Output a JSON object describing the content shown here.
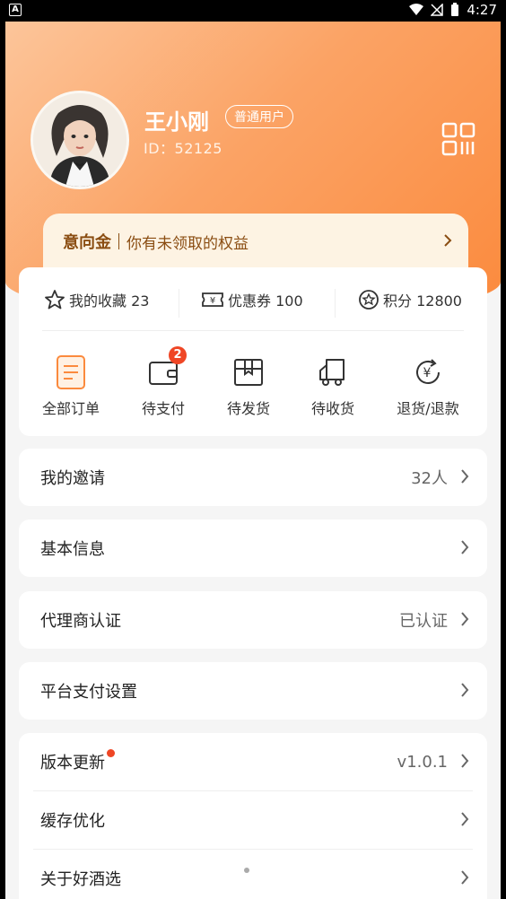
{
  "status_bar": {
    "time": "4:27",
    "left_icon": "A"
  },
  "profile": {
    "name": "王小刚",
    "tag": "普通用户",
    "id_text": "ID：52125"
  },
  "banner": {
    "title": "意向金",
    "text": "你有未领取的权益"
  },
  "stats": [
    {
      "icon": "star-icon",
      "label": "我的收藏 23"
    },
    {
      "icon": "coupon-icon",
      "label": "优惠券 100"
    },
    {
      "icon": "points-icon",
      "label": "积分 12800"
    }
  ],
  "orders": [
    {
      "icon": "order-list-icon",
      "label": "全部订单"
    },
    {
      "icon": "wallet-icon",
      "label": "待支付",
      "badge": "2"
    },
    {
      "icon": "package-icon",
      "label": "待发货"
    },
    {
      "icon": "truck-icon",
      "label": "待收货"
    },
    {
      "icon": "refund-icon",
      "label": "退货/退款"
    }
  ],
  "menu": {
    "invite": {
      "label": "我的邀请",
      "value": "32人"
    },
    "basic_info": {
      "label": "基本信息"
    },
    "agent_cert": {
      "label": "代理商认证",
      "value": "已认证"
    },
    "pay_settings": {
      "label": "平台支付设置"
    },
    "version": {
      "label": "版本更新",
      "value": "v1.0.1"
    },
    "cache": {
      "label": "缓存优化"
    },
    "about": {
      "label": "关于好酒选"
    }
  },
  "colors": {
    "accent": "#fb8a3d",
    "badge_red": "#ef4625",
    "banner_text": "#8a4d12"
  }
}
